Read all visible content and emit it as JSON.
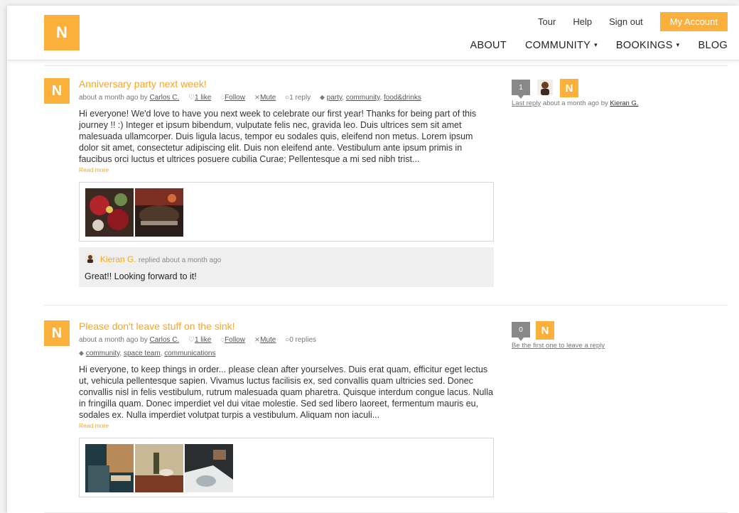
{
  "header": {
    "logo_letter": "N",
    "top_links": [
      "Tour",
      "Help",
      "Sign out"
    ],
    "account_button": "My Account",
    "nav": [
      "ABOUT",
      "COMMUNITY",
      "BOOKINGS",
      "BLOG"
    ]
  },
  "posts": [
    {
      "avatar_letter": "N",
      "title": "Anniversary party next week!",
      "meta_prefix": "about a month ago by",
      "author": "Carlos C.",
      "likes": "1 like",
      "follow": "Follow",
      "mute": "Mute",
      "replies_count": "1 reply",
      "tags": [
        "party",
        "community",
        "food&drinks"
      ],
      "body": "Hi everyone! We'd love to have you next week to celebrate our first year! Thanks for being part of this journey !! :) Integer et ipsum bibendum, vulputate felis nec, gravida leo. Duis ultrices sem sit amet malesuada ullamcorper. Duis ligula lacus, tempor eu sodales quis, eleifend non metus. Lorem ipsum dolor sit amet, consectetur adipiscing elit. Duis non eleifend ante. Vestibulum ante ipsum primis in faucibus orci luctus et ultrices posuere cubilia Curae; Pellentesque a mi sed nibh trist...",
      "read_more": "Read more",
      "reply": {
        "name": "Kieran G.",
        "meta": "replied about a month ago",
        "text": "Great!! Looking forward to it!"
      },
      "side": {
        "count": "1",
        "avatar_letter": "N",
        "last_reply_link": "Last reply",
        "last_reply_text": "about a month ago by",
        "last_reply_by": "Kieran G."
      }
    },
    {
      "avatar_letter": "N",
      "title": "Please don't leave stuff on the sink!",
      "meta_prefix": "about a month ago by",
      "author": "Carlos C.",
      "likes": "1 like",
      "follow": "Follow",
      "mute": "Mute",
      "replies_count": "0 replies",
      "tags": [
        "community",
        "space team",
        "communications"
      ],
      "body": "Hi everyone, to keep things in order... please clean after yourselves. Duis erat quam, efficitur eget lectus ut, vehicula pellentesque sapien. Vivamus luctus facilisis ex, sed convallis quam ultricies sed. Donec convallis nisl in felis vestibulum, rutrum malesuada quam pharetra. Quisque interdum congue lacus. Nulla in fringilla quam. Donec imperdiet vel dui vitae molestie. Sed sed libero laoreet, fermentum mauris eu, sodales ex. Nulla imperdiet volutpat turpis a vestibulum. Aliquam non iaculi...",
      "read_more": "Read more",
      "side": {
        "count": "0",
        "avatar_letter": "N",
        "first_reply_link": "Be the first one to leave a reply"
      }
    }
  ],
  "colors": {
    "accent": "#fbb03b",
    "title": "#f5a623",
    "badge": "#888888"
  }
}
